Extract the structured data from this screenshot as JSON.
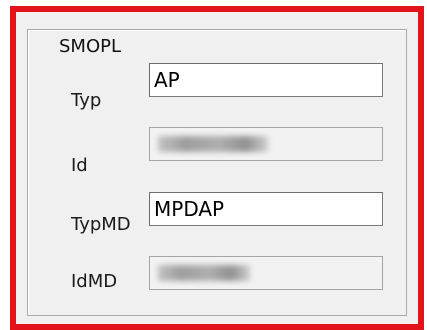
{
  "group": {
    "title": "SMOPL"
  },
  "fields": {
    "typ": {
      "label": "Typ",
      "value": "AP"
    },
    "id": {
      "label": "Id",
      "value": ""
    },
    "typmd": {
      "label": "TypMD",
      "value": "MPDAP"
    },
    "idmd": {
      "label": "IdMD",
      "value": ""
    }
  },
  "colors": {
    "frame_red": "#e3131b",
    "panel_background": "#f0f0f0"
  }
}
